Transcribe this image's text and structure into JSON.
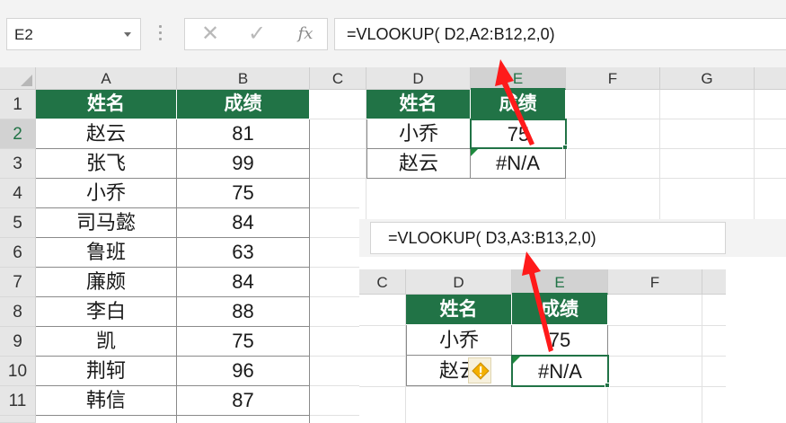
{
  "formula_bar": {
    "name_box": "E2",
    "cancel_glyph": "✕",
    "enter_glyph": "✓",
    "fx_label": "fx",
    "formula": "=VLOOKUP( D2,A2:B12,2,0)"
  },
  "columns": [
    "A",
    "B",
    "C",
    "D",
    "E",
    "F",
    "G"
  ],
  "rows": [
    "1",
    "2",
    "3",
    "4",
    "5",
    "6",
    "7",
    "8",
    "9",
    "10",
    "11"
  ],
  "table_main": {
    "headers": [
      "姓名",
      "成绩"
    ],
    "rows": [
      [
        "赵云",
        "81"
      ],
      [
        "张飞",
        "99"
      ],
      [
        "小乔",
        "75"
      ],
      [
        "司马懿",
        "84"
      ],
      [
        "鲁班",
        "63"
      ],
      [
        "廉颇",
        "84"
      ],
      [
        "李白",
        "88"
      ],
      [
        "凯",
        "75"
      ],
      [
        "荆轲",
        "96"
      ],
      [
        "韩信",
        "87"
      ],
      [
        "",
        ""
      ]
    ]
  },
  "table_lookup": {
    "headers": [
      "姓名",
      "成绩"
    ],
    "rows": [
      [
        "小乔",
        "75"
      ],
      [
        "赵云",
        "#N/A"
      ]
    ]
  },
  "inset": {
    "formula": "=VLOOKUP( D3,A3:B13,2,0)",
    "columns": [
      "C",
      "D",
      "E",
      "F"
    ],
    "headers": [
      "姓名",
      "成绩"
    ],
    "rows": [
      [
        "小乔",
        "75"
      ],
      [
        "赵云",
        "#N/A"
      ]
    ],
    "warning_icon": "exclamation-diamond-icon"
  },
  "colors": {
    "header_fill": "#217346",
    "arrow": "#ff1a1a",
    "selection": "#217346"
  }
}
